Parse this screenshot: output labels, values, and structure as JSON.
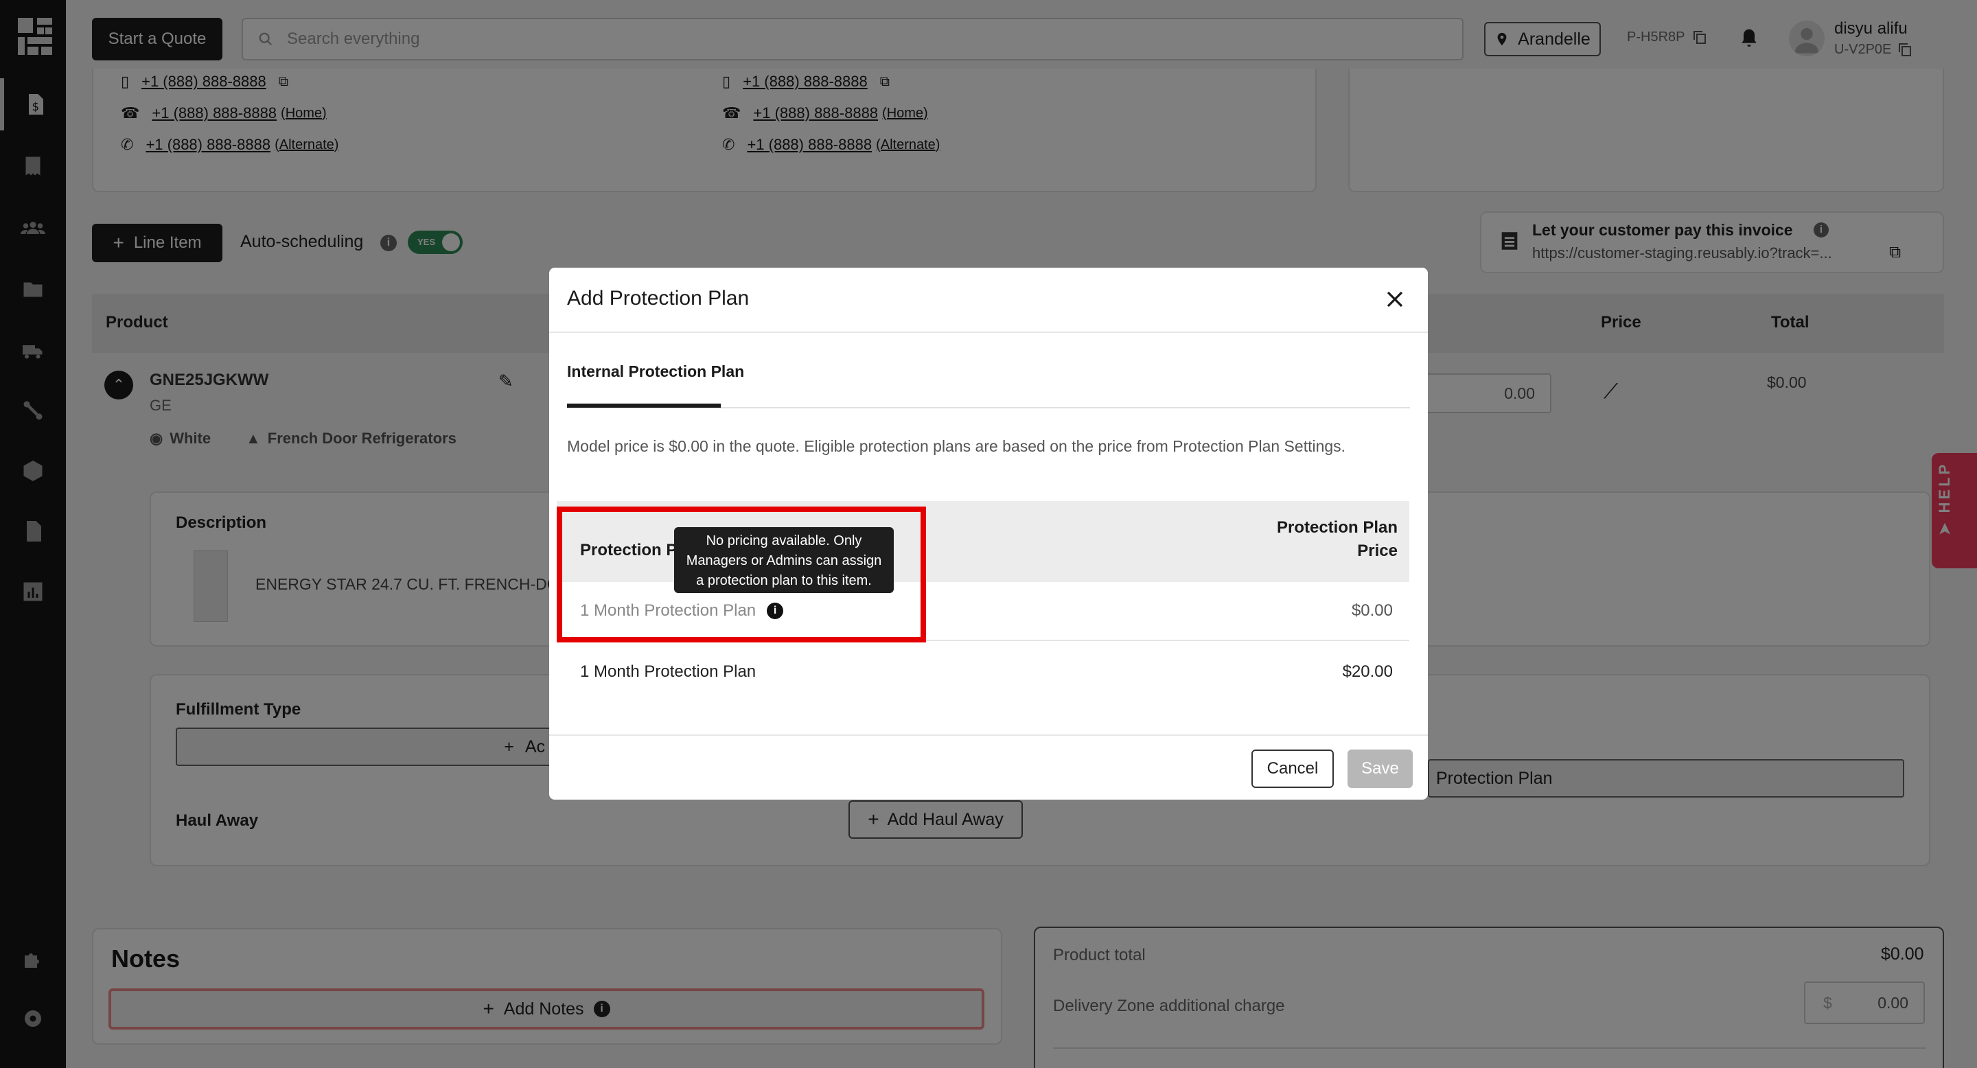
{
  "topbar": {
    "start_quote": "Start a Quote",
    "search_placeholder": "Search everything",
    "location": "Arandelle",
    "quote_code": "P-H5R8P",
    "user_name": "disyu alifu",
    "user_code": "U-V2P0E"
  },
  "contacts_left": {
    "mobile": "+1 (888) 888-8888",
    "home": "+1 (888) 888-8888",
    "home_tag": "(Home)",
    "alternate": "+1 (888) 888-8888",
    "alternate_tag": "(Alternate)"
  },
  "contacts_right": {
    "mobile": "+1 (888) 888-8888",
    "home": "+1 (888) 888-8888",
    "home_tag": "(Home)",
    "alternate": "+1 (888) 888-8888",
    "alternate_tag": "(Alternate)"
  },
  "toolbar": {
    "line_item": "Line Item",
    "auto_scheduling": "Auto-scheduling",
    "toggle_label": "YES"
  },
  "invoice": {
    "title": "Let your customer pay this invoice",
    "url": "https://customer-staging.reusably.io?track=..."
  },
  "product_table": {
    "col_product": "Product",
    "col_price": "Price",
    "col_total": "Total",
    "sku": "GNE25JGKWW",
    "brand": "GE",
    "color": "White",
    "category": "French Door Refrigerators",
    "price_value": "0.00",
    "total_value": "$0.00",
    "description_label": "Description",
    "description_text": "ENERGY STAR 24.7 CU. FT. FRENCH-DO",
    "fulfillment_label": "Fulfillment Type",
    "add_fulfillment": "Ac",
    "protection_plan_btn": "Protection Plan",
    "haul_away_label": "Haul Away",
    "add_haul_away": "Add Haul Away"
  },
  "notes": {
    "title": "Notes",
    "add_notes": "Add Notes"
  },
  "summary": {
    "product_total_label": "Product total",
    "product_total_value": "$0.00",
    "delivery_zone_label": "Delivery Zone additional charge",
    "delivery_currency": "$",
    "delivery_value": "0.00"
  },
  "help": {
    "label": "HELP"
  },
  "modal": {
    "title": "Add Protection Plan",
    "tab": "Internal Protection Plan",
    "description": "Model price is $0.00 in the quote. Eligible protection plans are based on the price from Protection Plan Settings.",
    "col_left": "Protection P",
    "col_right_line1": "Protection Plan",
    "col_right_line2": "Price",
    "rows": [
      {
        "name": "1 Month Protection Plan",
        "price": "$0.00"
      },
      {
        "name": "1 Month Protection Plan",
        "price": "$20.00"
      }
    ],
    "tooltip_line1": "No pricing available. Only",
    "tooltip_line2": "Managers or Admins can assign",
    "tooltip_line3": "a protection plan to this item.",
    "cancel": "Cancel",
    "save": "Save"
  }
}
